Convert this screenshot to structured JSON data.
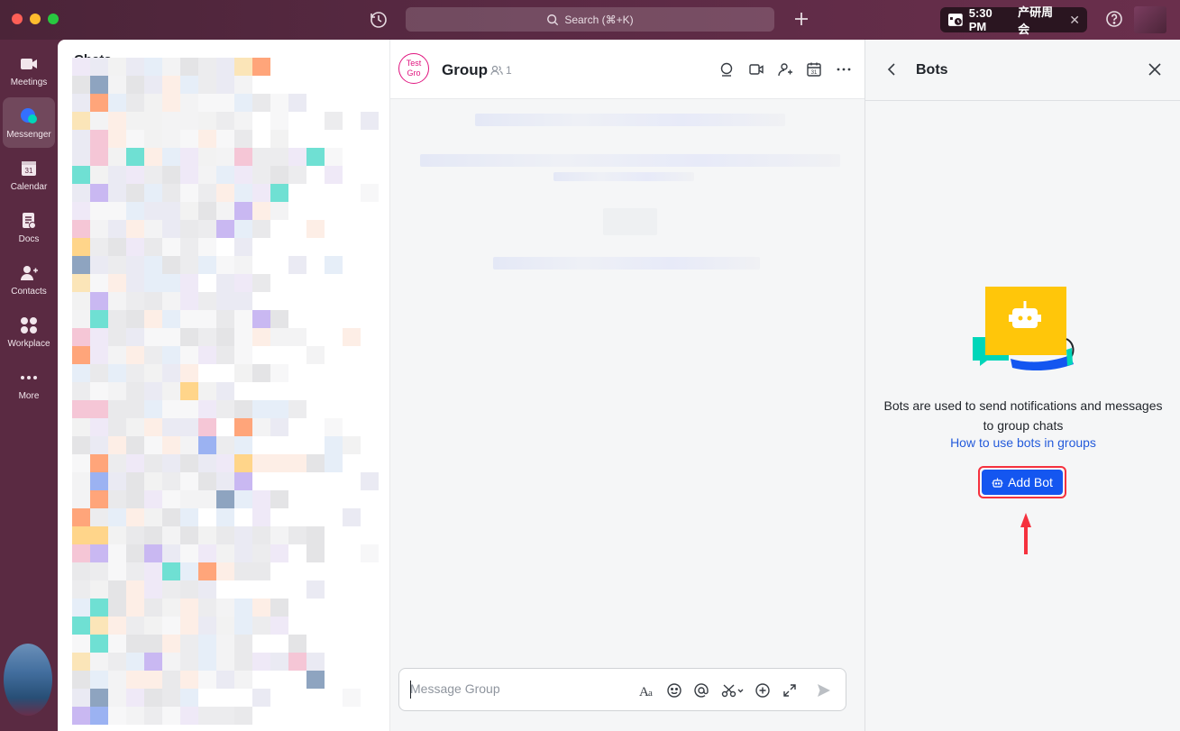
{
  "titlebar": {
    "search_label": "Search (⌘+K)",
    "meeting_time": "5:30 PM",
    "meeting_title": "产研周会",
    "meeting_close": "✕"
  },
  "rail": {
    "items": [
      {
        "label": "Meetings",
        "icon": "video-camera-icon"
      },
      {
        "label": "Messenger",
        "icon": "chat-bubble-icon"
      },
      {
        "label": "Calendar",
        "icon": "calendar-icon"
      },
      {
        "label": "Docs",
        "icon": "docs-icon"
      },
      {
        "label": "Contacts",
        "icon": "contacts-icon"
      },
      {
        "label": "Workplace",
        "icon": "grid-icon"
      },
      {
        "label": "More",
        "icon": "more-dots-icon"
      }
    ]
  },
  "chatlist": {
    "title": "Chats"
  },
  "chat": {
    "group_avatar_text": "Test Gro",
    "group_name": "Group",
    "member_count": "1",
    "composer_placeholder": "Message Group"
  },
  "bots": {
    "title": "Bots",
    "description": "Bots are used to send notifications and messages to group chats",
    "help_link": "How to use bots in groups",
    "add_button": "Add Bot"
  },
  "colors": {
    "accent": "#1456f0",
    "link": "#245bdb",
    "highlight": "#f5313e",
    "brand_sidebar": "#5a2a42",
    "group_avatar": "#e0157f"
  }
}
